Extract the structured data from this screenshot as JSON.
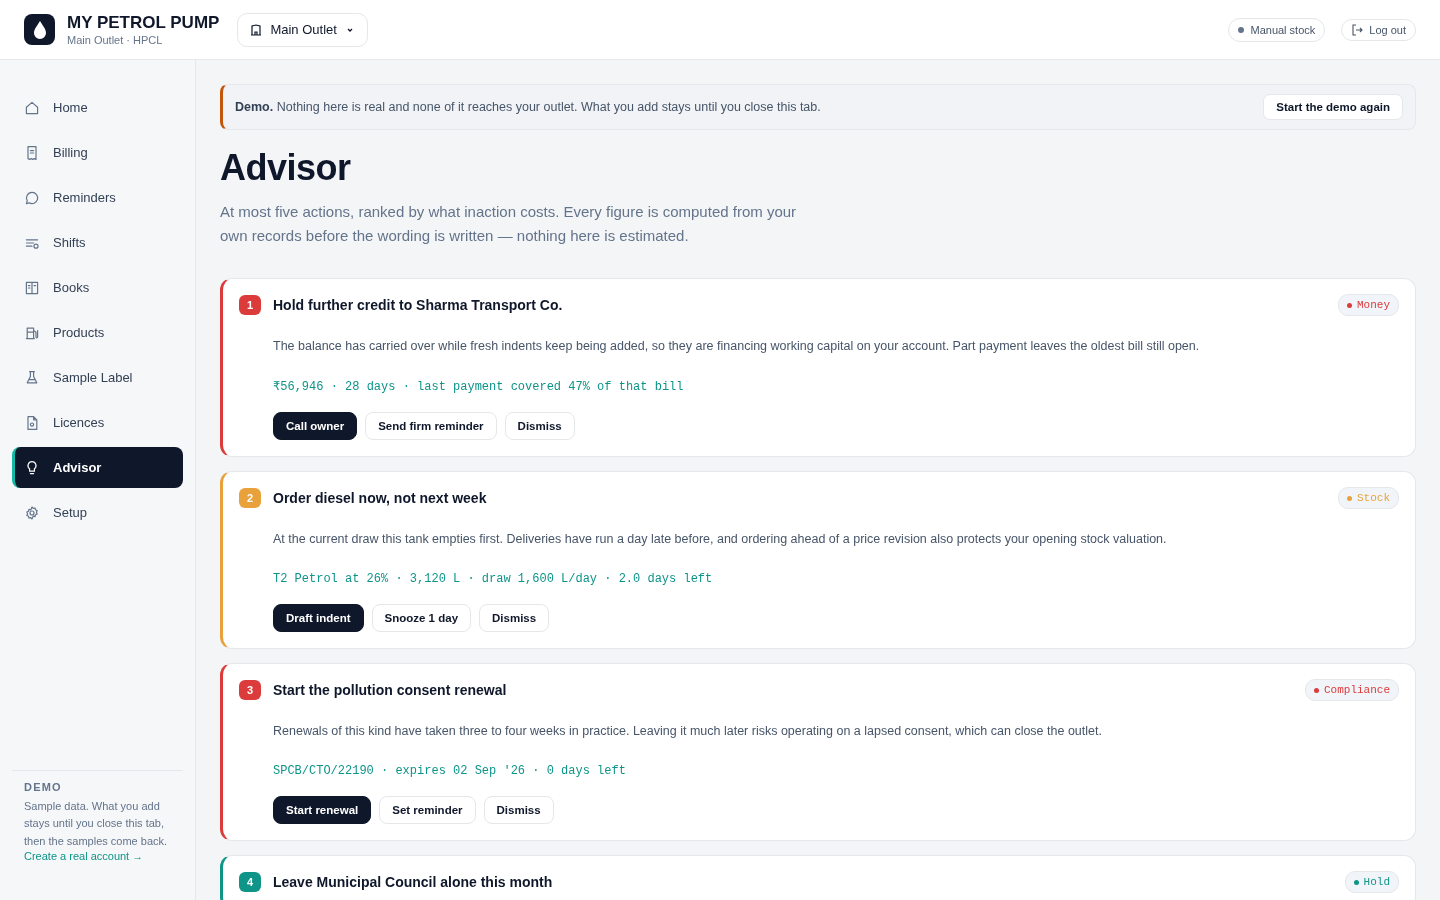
{
  "header": {
    "brand": "MY PETROL PUMP",
    "subtitle": "Main Outlet · HPCL",
    "outlet": "Main Outlet",
    "status": "Manual stock",
    "logout": "Log out"
  },
  "sidebar": {
    "items": [
      {
        "label": "Home",
        "selected": false
      },
      {
        "label": "Billing",
        "selected": false
      },
      {
        "label": "Reminders",
        "selected": false
      },
      {
        "label": "Shifts",
        "selected": false
      },
      {
        "label": "Books",
        "selected": false
      },
      {
        "label": "Products",
        "selected": false
      },
      {
        "label": "Sample Label",
        "selected": false
      },
      {
        "label": "Licences",
        "selected": false
      },
      {
        "label": "Advisor",
        "selected": true
      },
      {
        "label": "Setup",
        "selected": false
      }
    ],
    "demo": {
      "heading": "DEMO",
      "text": "Sample data. What you add stays until you close this tab, then the samples come back.",
      "link": "Create a real account →"
    }
  },
  "banner": {
    "text": "**Demo.** Nothing here is real and none of it reaches your outlet. What you add stays until you close this tab.",
    "button": "Start the demo again"
  },
  "page": {
    "title": "Advisor",
    "intro": "At most five actions, ranked by what inaction costs. Every figure is computed from your own records before the wording is written — nothing here is estimated."
  },
  "actions": [
    {
      "rank": "1",
      "title": "Hold further credit to Sharma Transport Co.",
      "tag": "Money",
      "color": "#dc3b3b",
      "body": "The balance has carried over while fresh indents keep being added, so they are financing working capital on your account. Part payment leaves the oldest bill still open.",
      "figures": "₹56,946 · 28 days · last payment covered 47% of that bill",
      "buttons": [
        {
          "label": "Call owner",
          "kind": "primary"
        },
        {
          "label": "Send firm reminder",
          "kind": "secondary"
        },
        {
          "label": "Dismiss",
          "kind": "secondary"
        }
      ]
    },
    {
      "rank": "2",
      "title": "Order diesel now, not next week",
      "tag": "Stock",
      "color": "#e9a23b",
      "body": "At the current draw this tank empties first. Deliveries have run a day late before, and ordering ahead of a price revision also protects your opening stock valuation.",
      "figures": "T2 Petrol at 26% · 3,120 L · draw 1,600 L/day · 2.0 days left",
      "buttons": [
        {
          "label": "Draft indent",
          "kind": "primary"
        },
        {
          "label": "Snooze 1 day",
          "kind": "secondary"
        },
        {
          "label": "Dismiss",
          "kind": "secondary"
        }
      ]
    },
    {
      "rank": "3",
      "title": "Start the pollution consent renewal",
      "tag": "Compliance",
      "color": "#dc3b3b",
      "body": "Renewals of this kind have taken three to four weeks in practice. Leaving it much later risks operating on a lapsed consent, which can close the outlet.",
      "figures": "SPCB/CTO/22190 · expires 02 Sep '26 · 0 days left",
      "buttons": [
        {
          "label": "Start renewal",
          "kind": "primary"
        },
        {
          "label": "Set reminder",
          "kind": "secondary"
        },
        {
          "label": "Dismiss",
          "kind": "secondary"
        }
      ]
    },
    {
      "rank": "4",
      "title": "Leave Municipal Council alone this month",
      "tag": "Hold",
      "color": "#0f9488"
    }
  ]
}
